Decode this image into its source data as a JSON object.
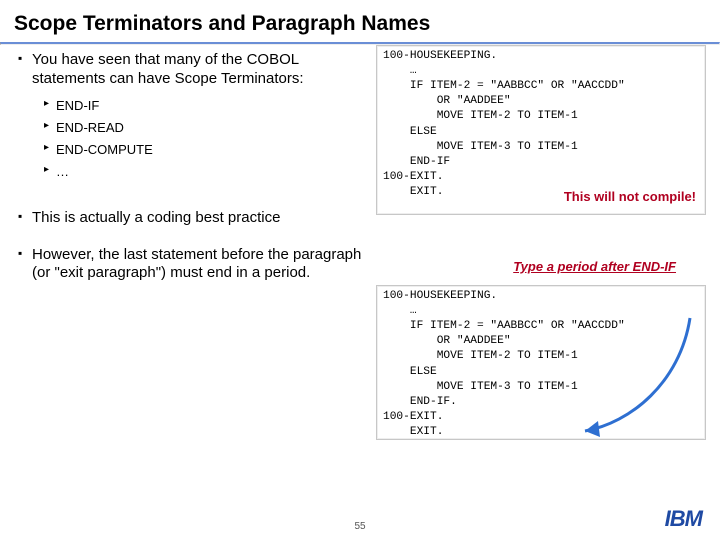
{
  "title": "Scope Terminators and Paragraph Names",
  "left": {
    "b1": "You have seen that many of the COBOL statements can have Scope Terminators:",
    "sub": [
      "END-IF",
      "END-READ",
      "END-COMPUTE",
      "…"
    ],
    "b2": "This is actually a coding best practice",
    "b3": "However, the last statement before the paragraph (or \"exit paragraph\") must end in a period."
  },
  "code1": "100-HOUSEKEEPING.\n    …\n    IF ITEM-2 = \"AABBCC\" OR \"AACCDD\"\n        OR \"AADDEE\"\n        MOVE ITEM-2 TO ITEM-1\n    ELSE\n        MOVE ITEM-3 TO ITEM-1\n    END-IF\n100-EXIT.\n    EXIT.",
  "note1": "This will not compile!",
  "note2": "Type a period after END-IF",
  "code2": "100-HOUSEKEEPING.\n    …\n    IF ITEM-2 = \"AABBCC\" OR \"AACCDD\"\n        OR \"AADDEE\"\n        MOVE ITEM-2 TO ITEM-1\n    ELSE\n        MOVE ITEM-3 TO ITEM-1\n    END-IF.\n100-EXIT.\n    EXIT.",
  "page": "55",
  "logo": "IBM"
}
